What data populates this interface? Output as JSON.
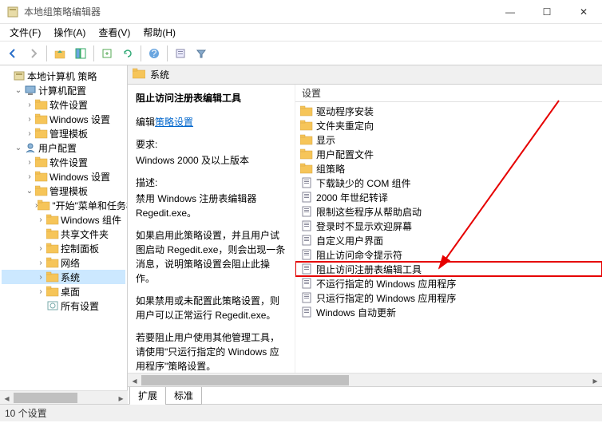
{
  "window": {
    "title": "本地组策略编辑器",
    "buttons": {
      "min": "—",
      "max": "☐",
      "close": "✕"
    }
  },
  "menubar": [
    "文件(F)",
    "操作(A)",
    "查看(V)",
    "帮助(H)"
  ],
  "toolbar_icons": [
    "back",
    "forward",
    "up",
    "show-hide",
    "export",
    "refresh",
    "help",
    "properties",
    "filter"
  ],
  "tree": [
    {
      "indent": 0,
      "exp": "",
      "icon": "root",
      "label": "本地计算机 策略"
    },
    {
      "indent": 1,
      "exp": "v",
      "icon": "computer",
      "label": "计算机配置"
    },
    {
      "indent": 2,
      "exp": ">",
      "icon": "folder",
      "label": "软件设置"
    },
    {
      "indent": 2,
      "exp": ">",
      "icon": "folder",
      "label": "Windows 设置"
    },
    {
      "indent": 2,
      "exp": ">",
      "icon": "folder",
      "label": "管理模板"
    },
    {
      "indent": 1,
      "exp": "v",
      "icon": "user",
      "label": "用户配置"
    },
    {
      "indent": 2,
      "exp": ">",
      "icon": "folder",
      "label": "软件设置"
    },
    {
      "indent": 2,
      "exp": ">",
      "icon": "folder",
      "label": "Windows 设置"
    },
    {
      "indent": 2,
      "exp": "v",
      "icon": "folder",
      "label": "管理模板"
    },
    {
      "indent": 3,
      "exp": ">",
      "icon": "folder",
      "label": "\"开始\"菜单和任务栏"
    },
    {
      "indent": 3,
      "exp": ">",
      "icon": "folder",
      "label": "Windows 组件"
    },
    {
      "indent": 3,
      "exp": "",
      "icon": "folder",
      "label": "共享文件夹"
    },
    {
      "indent": 3,
      "exp": ">",
      "icon": "folder",
      "label": "控制面板"
    },
    {
      "indent": 3,
      "exp": ">",
      "icon": "folder",
      "label": "网络"
    },
    {
      "indent": 3,
      "exp": ">",
      "icon": "folder",
      "label": "系统",
      "selected": true
    },
    {
      "indent": 3,
      "exp": ">",
      "icon": "folder",
      "label": "桌面"
    },
    {
      "indent": 3,
      "exp": "",
      "icon": "settings",
      "label": "所有设置"
    }
  ],
  "content": {
    "header": "系统",
    "detail": {
      "title": "阻止访问注册表编辑工具",
      "edit_prefix": "编辑",
      "edit_link": "策略设置",
      "req_label": "要求:",
      "req_text": "Windows 2000 及以上版本",
      "desc_label": "描述:",
      "desc_p1": "禁用 Windows 注册表编辑器 Regedit.exe。",
      "desc_p2": "如果启用此策略设置，并且用户试图启动 Regedit.exe，则会出现一条消息，说明策略设置会阻止此操作。",
      "desc_p3": "如果禁用或未配置此策略设置，则用户可以正常运行 Regedit.exe。",
      "desc_p4": "若要阻止用户使用其他管理工具，请使用\"只运行指定的 Windows 应用程序\"策略设置。"
    },
    "list_header": "设置",
    "list": [
      {
        "icon": "folder",
        "label": "驱动程序安装"
      },
      {
        "icon": "folder",
        "label": "文件夹重定向"
      },
      {
        "icon": "folder",
        "label": "显示"
      },
      {
        "icon": "folder",
        "label": "用户配置文件"
      },
      {
        "icon": "folder",
        "label": "组策略"
      },
      {
        "icon": "policy",
        "label": "下载缺少的 COM 组件"
      },
      {
        "icon": "policy",
        "label": "2000 年世纪转译"
      },
      {
        "icon": "policy",
        "label": "限制这些程序从帮助启动"
      },
      {
        "icon": "policy",
        "label": "登录时不显示欢迎屏幕"
      },
      {
        "icon": "policy",
        "label": "自定义用户界面"
      },
      {
        "icon": "policy",
        "label": "阻止访问命令提示符"
      },
      {
        "icon": "policy",
        "label": "阻止访问注册表编辑工具",
        "highlight": true
      },
      {
        "icon": "policy",
        "label": "不运行指定的 Windows 应用程序"
      },
      {
        "icon": "policy",
        "label": "只运行指定的 Windows 应用程序"
      },
      {
        "icon": "policy",
        "label": "Windows 自动更新"
      }
    ],
    "tabs": [
      "扩展",
      "标准"
    ]
  },
  "statusbar": "10 个设置"
}
